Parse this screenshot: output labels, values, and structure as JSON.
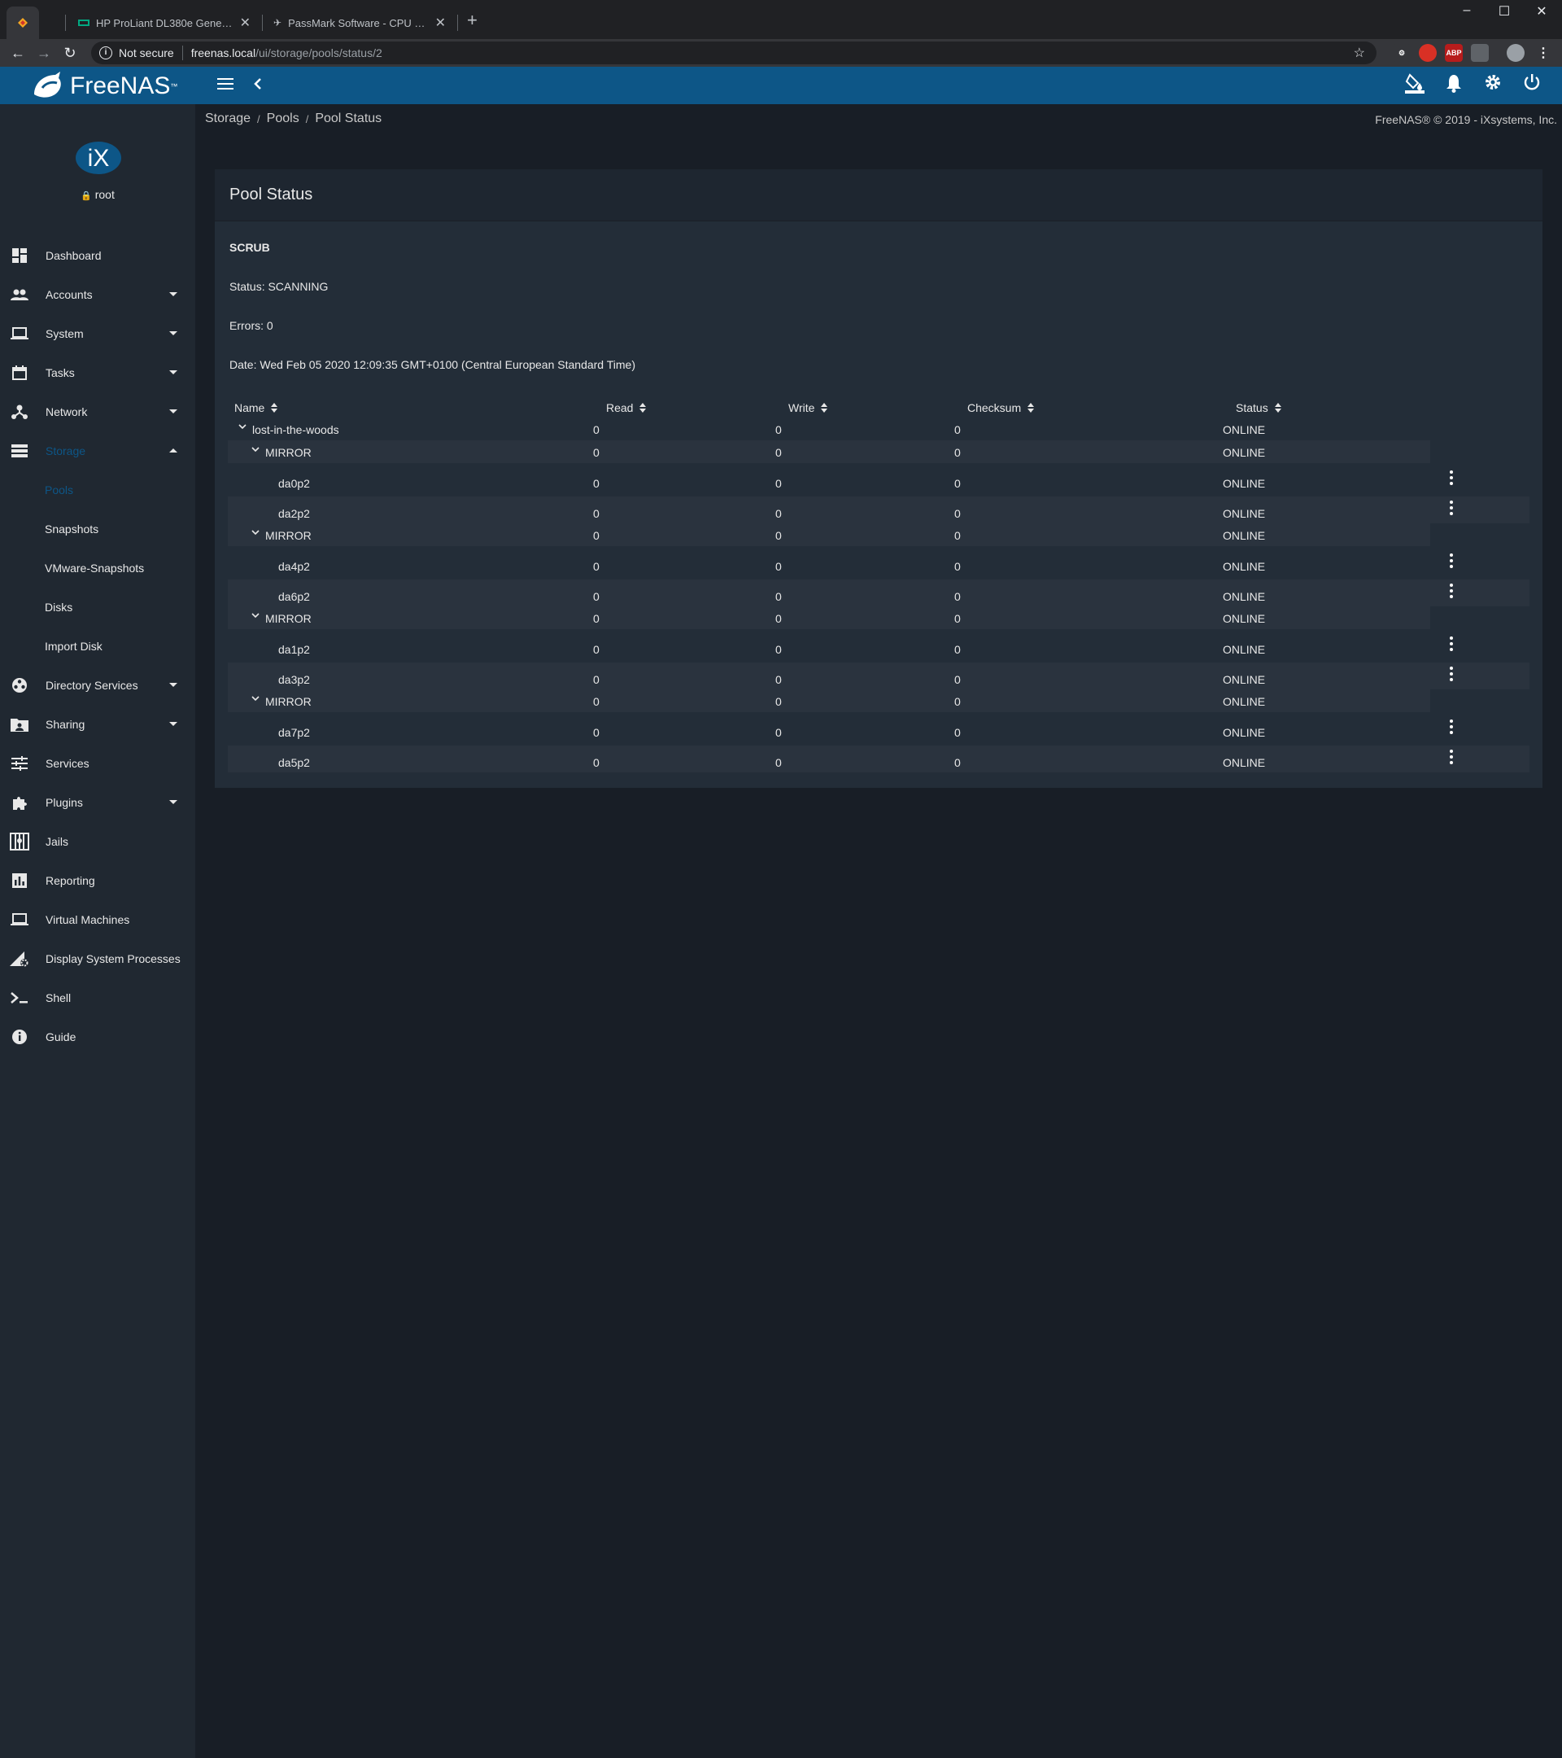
{
  "browser": {
    "tabs": [
      {
        "label": ""
      },
      {
        "label": "HP ProLiant DL380e Generation 8"
      },
      {
        "label": "PassMark Software - CPU Benchmarks"
      }
    ],
    "security_label": "Not secure",
    "url_host": "freenas.local",
    "url_path": "/ui/storage/pools/status/2",
    "extensions": [
      {
        "name": "ext-1",
        "color": "#35363a",
        "text": ""
      },
      {
        "name": "ext-2",
        "color": "#d93025",
        "text": ""
      },
      {
        "name": "adblock",
        "color": "#b71c1c",
        "text": "ABP"
      },
      {
        "name": "ext-4",
        "color": "#5f6368",
        "text": ""
      }
    ]
  },
  "app": {
    "brand": "FreeNAS",
    "user": "root",
    "breadcrumb": [
      "Storage",
      "Pools",
      "Pool Status"
    ],
    "copyright": "FreeNAS® © 2019 - iXsystems, Inc.",
    "accent_color": "#0d5687"
  },
  "sidebar": {
    "items": [
      {
        "label": "Dashboard",
        "icon": "dashboard-icon",
        "caret": false
      },
      {
        "label": "Accounts",
        "icon": "people-icon",
        "caret": true
      },
      {
        "label": "System",
        "icon": "laptop-icon",
        "caret": true
      },
      {
        "label": "Tasks",
        "icon": "calendar-icon",
        "caret": true
      },
      {
        "label": "Network",
        "icon": "network-icon",
        "caret": true
      },
      {
        "label": "Storage",
        "icon": "storage-icon",
        "caret": true,
        "active": true
      },
      {
        "label": "Directory Services",
        "icon": "directory-icon",
        "caret": true
      },
      {
        "label": "Sharing",
        "icon": "sharing-icon",
        "caret": true
      },
      {
        "label": "Services",
        "icon": "tune-icon",
        "caret": false
      },
      {
        "label": "Plugins",
        "icon": "puzzle-icon",
        "caret": true
      },
      {
        "label": "Jails",
        "icon": "jail-icon",
        "caret": false
      },
      {
        "label": "Reporting",
        "icon": "chart-icon",
        "caret": false
      },
      {
        "label": "Virtual Machines",
        "icon": "laptop-icon",
        "caret": false
      },
      {
        "label": "Display System Processes",
        "icon": "processes-icon",
        "caret": false
      },
      {
        "label": "Shell",
        "icon": "terminal-icon",
        "caret": false
      },
      {
        "label": "Guide",
        "icon": "info-icon",
        "caret": false
      }
    ],
    "storage_subitems": [
      {
        "label": "Pools",
        "active": true
      },
      {
        "label": "Snapshots"
      },
      {
        "label": "VMware-Snapshots"
      },
      {
        "label": "Disks"
      },
      {
        "label": "Import Disk"
      }
    ]
  },
  "pool_status": {
    "title": "Pool Status",
    "scrub_title": "SCRUB",
    "status_line": "Status: SCANNING",
    "errors_line": "Errors: 0",
    "date_line": "Date: Wed Feb 05 2020 12:09:35 GMT+0100 (Central European Standard Time)",
    "columns": [
      "Name",
      "Read",
      "Write",
      "Checksum",
      "Status"
    ],
    "rows": [
      {
        "level": 0,
        "name": "lost-in-the-woods",
        "read": "0",
        "write": "0",
        "checksum": "0",
        "status": "ONLINE",
        "expandable": true
      },
      {
        "level": 1,
        "name": "MIRROR",
        "read": "0",
        "write": "0",
        "checksum": "0",
        "status": "ONLINE",
        "expandable": true
      },
      {
        "level": 2,
        "name": "da0p2",
        "read": "0",
        "write": "0",
        "checksum": "0",
        "status": "ONLINE"
      },
      {
        "level": 2,
        "name": "da2p2",
        "read": "0",
        "write": "0",
        "checksum": "0",
        "status": "ONLINE"
      },
      {
        "level": 1,
        "name": "MIRROR",
        "read": "0",
        "write": "0",
        "checksum": "0",
        "status": "ONLINE",
        "expandable": true
      },
      {
        "level": 2,
        "name": "da4p2",
        "read": "0",
        "write": "0",
        "checksum": "0",
        "status": "ONLINE"
      },
      {
        "level": 2,
        "name": "da6p2",
        "read": "0",
        "write": "0",
        "checksum": "0",
        "status": "ONLINE"
      },
      {
        "level": 1,
        "name": "MIRROR",
        "read": "0",
        "write": "0",
        "checksum": "0",
        "status": "ONLINE",
        "expandable": true
      },
      {
        "level": 2,
        "name": "da1p2",
        "read": "0",
        "write": "0",
        "checksum": "0",
        "status": "ONLINE"
      },
      {
        "level": 2,
        "name": "da3p2",
        "read": "0",
        "write": "0",
        "checksum": "0",
        "status": "ONLINE"
      },
      {
        "level": 1,
        "name": "MIRROR",
        "read": "0",
        "write": "0",
        "checksum": "0",
        "status": "ONLINE",
        "expandable": true
      },
      {
        "level": 2,
        "name": "da7p2",
        "read": "0",
        "write": "0",
        "checksum": "0",
        "status": "ONLINE"
      },
      {
        "level": 2,
        "name": "da5p2",
        "read": "0",
        "write": "0",
        "checksum": "0",
        "status": "ONLINE"
      }
    ]
  }
}
